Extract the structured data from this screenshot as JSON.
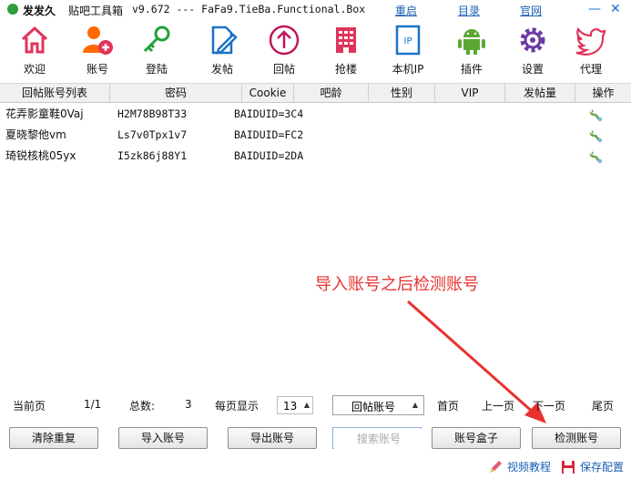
{
  "titlebar": {
    "app_name": "发发久",
    "app_sub": "贴吧工具箱",
    "version": "v9.672 --- FaFa9.TieBa.Functional.Box",
    "links": [
      "重启",
      "目录",
      "官网"
    ],
    "minimize": "—",
    "close": "✕"
  },
  "toolbar": [
    {
      "label": "欢迎",
      "icon": "home-icon",
      "color": "#e0335b"
    },
    {
      "label": "账号",
      "icon": "add-user-icon",
      "color": "#ff6a00"
    },
    {
      "label": "登陆",
      "icon": "key-icon",
      "color": "#1ea23a"
    },
    {
      "label": "发帖",
      "icon": "edit-doc-icon",
      "color": "#1a73c8"
    },
    {
      "label": "回帖",
      "icon": "reply-up-icon",
      "color": "#c0185f"
    },
    {
      "label": "抢楼",
      "icon": "building-icon",
      "color": "#e0335b"
    },
    {
      "label": "本机IP",
      "icon": "ip-icon",
      "color": "#1a73c8"
    },
    {
      "label": "插件",
      "icon": "android-icon",
      "color": "#5aa832"
    },
    {
      "label": "设置",
      "icon": "gear-icon",
      "color": "#6b3aa6"
    },
    {
      "label": "代理",
      "icon": "bird-icon",
      "color": "#e0335b"
    }
  ],
  "table": {
    "columns": [
      "回帖账号列表",
      "密码",
      "Cookie",
      "吧龄",
      "性别",
      "VIP",
      "发帖量",
      "操作"
    ],
    "rows": [
      {
        "account": "花弄影童鞋0Vaj",
        "password": "H2M78B98T33",
        "cookie": "BAIDUID=3C4"
      },
      {
        "account": "夏晓黎他vm",
        "password": "Ls7v0Tpx1v7",
        "cookie": "BAIDUID=FC2"
      },
      {
        "account": "琦锐核桃05yx",
        "password": "I5zk86j88Y1",
        "cookie": "BAIDUID=2DA"
      }
    ]
  },
  "annotation": "导入账号之后检测账号",
  "pager": {
    "current_page_label": "当前页",
    "current_page_value": "1/1",
    "total_label": "总数:",
    "total_value": "3",
    "per_page_label": "每页显示",
    "per_page_value": "13",
    "account_type": "回帖账号",
    "first": "首页",
    "prev": "上一页",
    "next": "下一页",
    "last": "尾页"
  },
  "buttons": {
    "dedupe": "清除重复",
    "import": "导入账号",
    "export": "导出账号",
    "search_placeholder": "搜索账号",
    "account_box": "账号盒子",
    "check": "检测账号"
  },
  "footer": {
    "video_tutorial": "视频教程",
    "save_config": "保存配置"
  },
  "colors": {
    "accent_blue": "#1a5fb4",
    "annotation_red": "#e8322f"
  }
}
